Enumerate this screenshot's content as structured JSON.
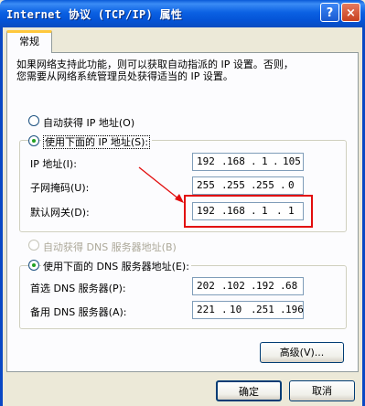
{
  "window": {
    "title": "Internet 协议 (TCP/IP) 属性",
    "help_icon": "?",
    "close_icon": "×"
  },
  "tabs": [
    {
      "label": "常规",
      "active": true
    }
  ],
  "description": [
    "如果网络支持此功能，则可以获取自动指派的 IP 设置。否则，",
    "您需要从网络系统管理员处获得适当的 IP 设置。"
  ],
  "ip_mode": {
    "auto": {
      "label": "自动获得 IP 地址(O)",
      "selected": false,
      "enabled": true
    },
    "manual": {
      "label": "使用下面的 IP 地址(S):",
      "selected": true,
      "enabled": true
    }
  },
  "ip_fields": [
    {
      "label": "IP 地址(I):",
      "octets": [
        "192",
        "168",
        "1",
        "105"
      ]
    },
    {
      "label": "子网掩码(U):",
      "octets": [
        "255",
        "255",
        "255",
        "0"
      ]
    },
    {
      "label": "默认网关(D):",
      "octets": [
        "192",
        "168",
        "1",
        "1"
      ],
      "highlighted": true
    }
  ],
  "dns_mode": {
    "auto": {
      "label": "自动获得 DNS 服务器地址(B)",
      "selected": false,
      "enabled": false
    },
    "manual": {
      "label": "使用下面的 DNS 服务器地址(E):",
      "selected": true,
      "enabled": true
    }
  },
  "dns_fields": [
    {
      "label": "首选 DNS 服务器(P):",
      "octets": [
        "202",
        "102",
        "192",
        "68"
      ]
    },
    {
      "label": "备用 DNS 服务器(A):",
      "octets": [
        "221",
        "10",
        "251",
        "196"
      ]
    }
  ],
  "buttons": {
    "advanced": "高级(V)...",
    "ok": "确定",
    "cancel": "取消"
  },
  "colors": {
    "titlebar": "#0a5ad8",
    "highlight_box": "#e20d0d",
    "arrow": "#e20d0d",
    "tab_accent": "#ffc83c"
  }
}
